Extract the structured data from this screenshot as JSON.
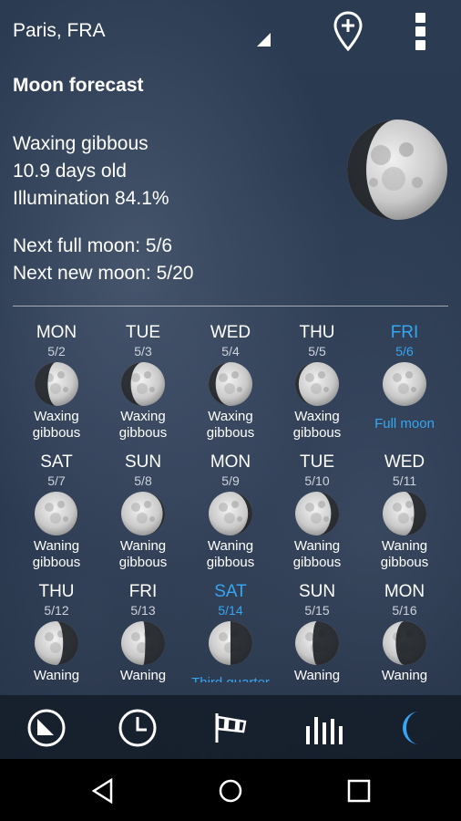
{
  "header": {
    "location": "Paris, FRA"
  },
  "moon_forecast": {
    "title": "Moon forecast",
    "phase": "Waxing gibbous",
    "age": "10.9 days old",
    "illumination": "Illumination 84.1%",
    "next_full": "Next full moon: 5/6",
    "next_new": "Next new moon: 5/20"
  },
  "days": [
    {
      "day": "MON",
      "date": "5/2",
      "phase": "Waxing gibbous",
      "illum": 0.7,
      "wax": true,
      "hl": false
    },
    {
      "day": "TUE",
      "date": "5/3",
      "phase": "Waxing gibbous",
      "illum": 0.78,
      "wax": true,
      "hl": false
    },
    {
      "day": "WED",
      "date": "5/4",
      "phase": "Waxing gibbous",
      "illum": 0.84,
      "wax": true,
      "hl": false
    },
    {
      "day": "THU",
      "date": "5/5",
      "phase": "Waxing gibbous",
      "illum": 0.92,
      "wax": true,
      "hl": false
    },
    {
      "day": "FRI",
      "date": "5/6",
      "phase": "Full moon",
      "illum": 1.0,
      "wax": true,
      "hl": true
    },
    {
      "day": "SAT",
      "date": "5/7",
      "phase": "Waning gibbous",
      "illum": 0.98,
      "wax": false,
      "hl": false
    },
    {
      "day": "SUN",
      "date": "5/8",
      "phase": "Waning gibbous",
      "illum": 0.95,
      "wax": false,
      "hl": false
    },
    {
      "day": "MON",
      "date": "5/9",
      "phase": "Waning gibbous",
      "illum": 0.9,
      "wax": false,
      "hl": false
    },
    {
      "day": "TUE",
      "date": "5/10",
      "phase": "Waning gibbous",
      "illum": 0.82,
      "wax": false,
      "hl": false
    },
    {
      "day": "WED",
      "date": "5/11",
      "phase": "Waning gibbous",
      "illum": 0.72,
      "wax": false,
      "hl": false
    },
    {
      "day": "THU",
      "date": "5/12",
      "phase": "Waning",
      "illum": 0.65,
      "wax": false,
      "hl": false
    },
    {
      "day": "FRI",
      "date": "5/13",
      "phase": "Waning",
      "illum": 0.55,
      "wax": false,
      "hl": false
    },
    {
      "day": "SAT",
      "date": "5/14",
      "phase": "Third quarter",
      "illum": 0.5,
      "wax": false,
      "hl": true
    },
    {
      "day": "SUN",
      "date": "5/15",
      "phase": "Waning",
      "illum": 0.4,
      "wax": false,
      "hl": false
    },
    {
      "day": "MON",
      "date": "5/16",
      "phase": "Waning",
      "illum": 0.3,
      "wax": false,
      "hl": false
    }
  ],
  "colors": {
    "accent": "#35a6f2",
    "nav_bg": "#141c28"
  },
  "bottom_nav": [
    {
      "name": "clock-face-icon"
    },
    {
      "name": "clock-icon"
    },
    {
      "name": "windsock-icon"
    },
    {
      "name": "bar-chart-icon"
    },
    {
      "name": "crescent-moon-icon",
      "active": true
    }
  ]
}
